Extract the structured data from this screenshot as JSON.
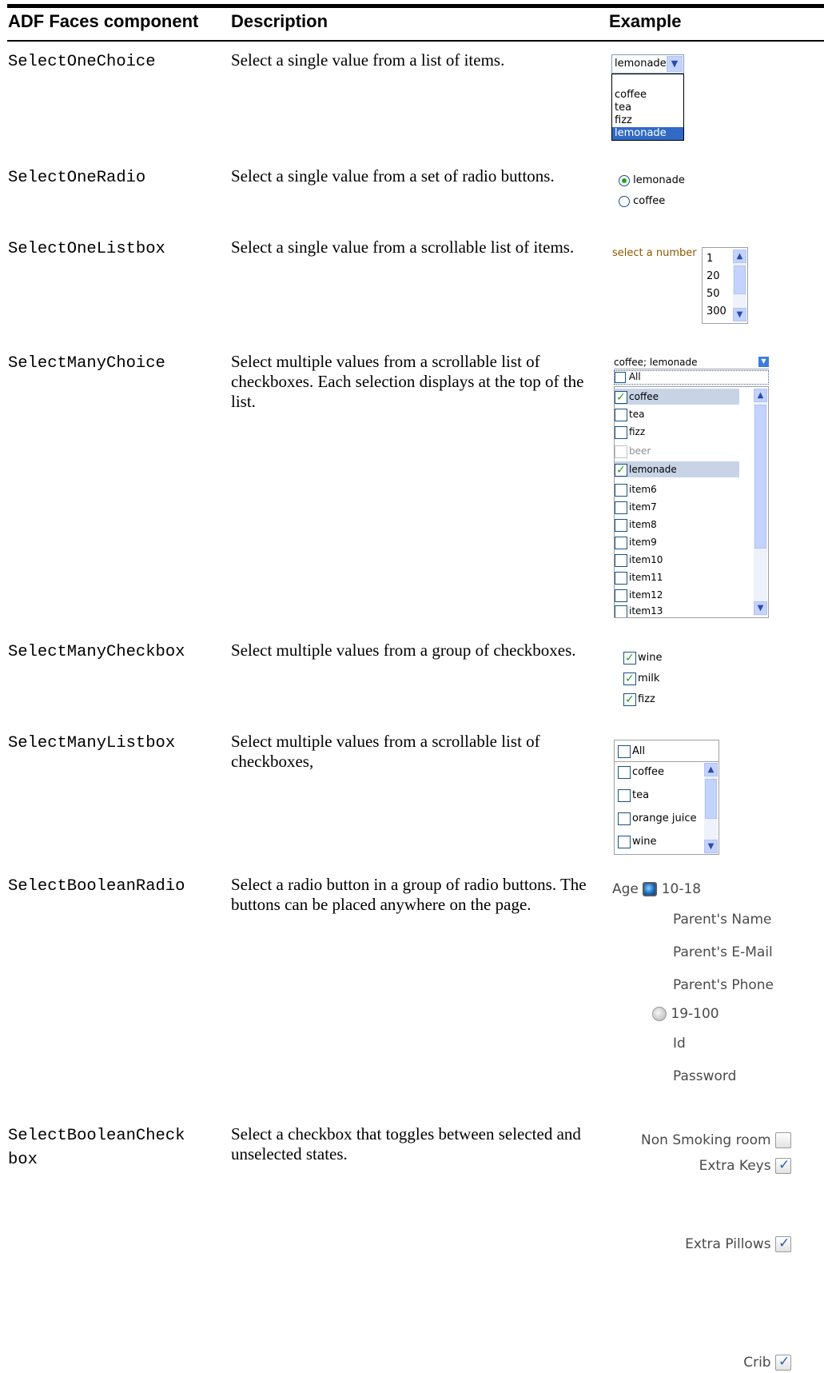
{
  "header": {
    "col1": "ADF Faces component",
    "col2": "Description",
    "col3": "Example"
  },
  "rows": [
    {
      "component": "SelectOneChoice",
      "description": "Select a single value from a list of items.",
      "example": {
        "selected": "lemonade",
        "options": [
          "coffee",
          "tea",
          "fizz",
          "lemonade"
        ],
        "dropdown_icon": "chevron-down-icon"
      }
    },
    {
      "component": "SelectOneRadio",
      "description": "Select a single value from a set of radio buttons.",
      "example": {
        "options": [
          "lemonade",
          "coffee"
        ],
        "selected": "lemonade"
      }
    },
    {
      "component": "SelectOneListbox",
      "description": "Select a single value from a scrollable list of items.",
      "example": {
        "label": "select a number",
        "options": [
          "1",
          "20",
          "50",
          "300"
        ]
      }
    },
    {
      "component": "SelectManyChoice",
      "description": "Select multiple values from a scrollable list of checkboxes. Each selection displays at the top of the list.",
      "example": {
        "display_value": "coffee; lemonade",
        "all_label": "All",
        "items": [
          "coffee",
          "tea",
          "fizz",
          "beer",
          "lemonade",
          "item6",
          "item7",
          "item8",
          "item9",
          "item10",
          "item11",
          "item12",
          "item13"
        ],
        "checked": [
          "coffee",
          "lemonade"
        ],
        "disabled": [
          "beer"
        ]
      }
    },
    {
      "component": "SelectManyCheckbox",
      "description": "Select multiple values from a group of checkboxes.",
      "example": {
        "items": [
          "wine",
          "milk",
          "fizz"
        ],
        "checked": [
          "wine",
          "milk",
          "fizz"
        ]
      }
    },
    {
      "component": "SelectManyListbox",
      "description": "Select multiple values from a scrollable list of checkboxes,",
      "example": {
        "all_label": "All",
        "items": [
          "coffee",
          "tea",
          "orange juice",
          "wine"
        ]
      }
    },
    {
      "component": "SelectBooleanRadio",
      "description": "Select a radio button in a group of radio buttons. The buttons can be placed anywhere on the page.",
      "example": {
        "group_label": "Age",
        "option1": "10-18",
        "option1_fields": [
          "Parent's Name",
          "Parent's E-Mail",
          "Parent's Phone"
        ],
        "option2": "19-100",
        "option2_fields": [
          "Id",
          "Password"
        ]
      }
    },
    {
      "component_line1": "SelectBooleanCheck",
      "component_line2": "box",
      "description": "Select a checkbox that toggles between selected and unselected states.",
      "example": {
        "items": [
          "Non Smoking room",
          "Extra Keys",
          "Extra Pillows",
          "Crib"
        ],
        "checked": [
          "Extra Keys",
          "Extra Pillows",
          "Crib"
        ]
      }
    }
  ]
}
